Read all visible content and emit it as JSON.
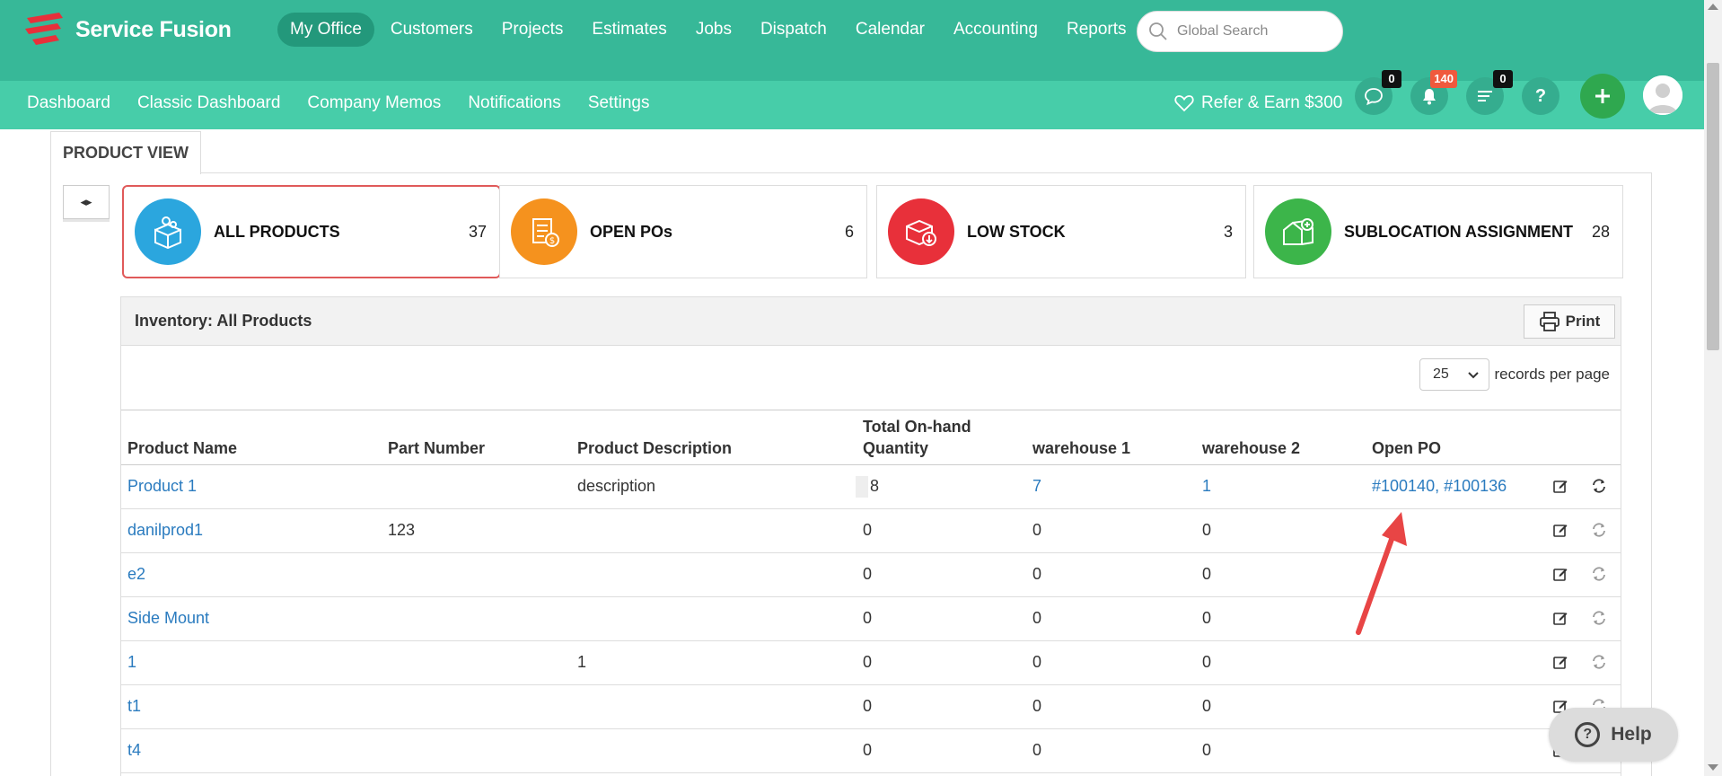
{
  "app": {
    "name": "Service Fusion",
    "brand_color": "#37b898",
    "subbar_color": "#47cda9"
  },
  "main_nav": [
    {
      "label": "My Office",
      "active": true
    },
    {
      "label": "Customers"
    },
    {
      "label": "Projects"
    },
    {
      "label": "Estimates"
    },
    {
      "label": "Jobs"
    },
    {
      "label": "Dispatch"
    },
    {
      "label": "Calendar"
    },
    {
      "label": "Accounting"
    },
    {
      "label": "Reports"
    }
  ],
  "search": {
    "placeholder": "Global Search"
  },
  "sub_nav": [
    {
      "label": "Dashboard"
    },
    {
      "label": "Classic Dashboard"
    },
    {
      "label": "Company Memos"
    },
    {
      "label": "Notifications"
    },
    {
      "label": "Settings"
    }
  ],
  "refer": {
    "label": "Refer & Earn $300"
  },
  "header_icons": {
    "chat_count": "0",
    "notifications_count": "140",
    "tasks_count": "0",
    "help_label": "?"
  },
  "panel": {
    "tab_label": "PRODUCT VIEW",
    "collapse_label": "◂▸"
  },
  "cards": [
    {
      "label": "ALL PRODUCTS",
      "count": "37",
      "color": "#2ba6de",
      "selected": true
    },
    {
      "label": "OPEN POs",
      "count": "6",
      "color": "#f5921e"
    },
    {
      "label": "LOW STOCK",
      "count": "3",
      "color": "#e8303a"
    },
    {
      "label": "SUBLOCATION ASSIGNMENT",
      "count": "28",
      "color": "#3cb54a"
    }
  ],
  "inventory": {
    "title": "Inventory: All Products",
    "print_label": "Print",
    "per_page": "25",
    "per_page_label": "records per page",
    "columns": [
      "Product Name",
      "Part Number",
      "Product Description",
      "Total On-hand Quantity",
      "warehouse 1",
      "warehouse 2",
      "Open PO"
    ],
    "rows": [
      {
        "name": "Product 1",
        "part": "",
        "desc": "description",
        "total": "8",
        "w1": "7",
        "w2": "1",
        "po": "#100140, #100136"
      },
      {
        "name": "danilprod1",
        "part": "123",
        "desc": "",
        "total": "0",
        "w1": "0",
        "w2": "0",
        "po": ""
      },
      {
        "name": "e2",
        "part": "",
        "desc": "",
        "total": "0",
        "w1": "0",
        "w2": "0",
        "po": ""
      },
      {
        "name": "Side Mount",
        "part": "",
        "desc": "",
        "total": "0",
        "w1": "0",
        "w2": "0",
        "po": ""
      },
      {
        "name": "1",
        "part": "",
        "desc": "1",
        "total": "0",
        "w1": "0",
        "w2": "0",
        "po": ""
      },
      {
        "name": "t1",
        "part": "",
        "desc": "",
        "total": "0",
        "w1": "0",
        "w2": "0",
        "po": ""
      },
      {
        "name": "t4",
        "part": "",
        "desc": "",
        "total": "0",
        "w1": "0",
        "w2": "0",
        "po": ""
      }
    ]
  },
  "help": {
    "label": "Help"
  }
}
